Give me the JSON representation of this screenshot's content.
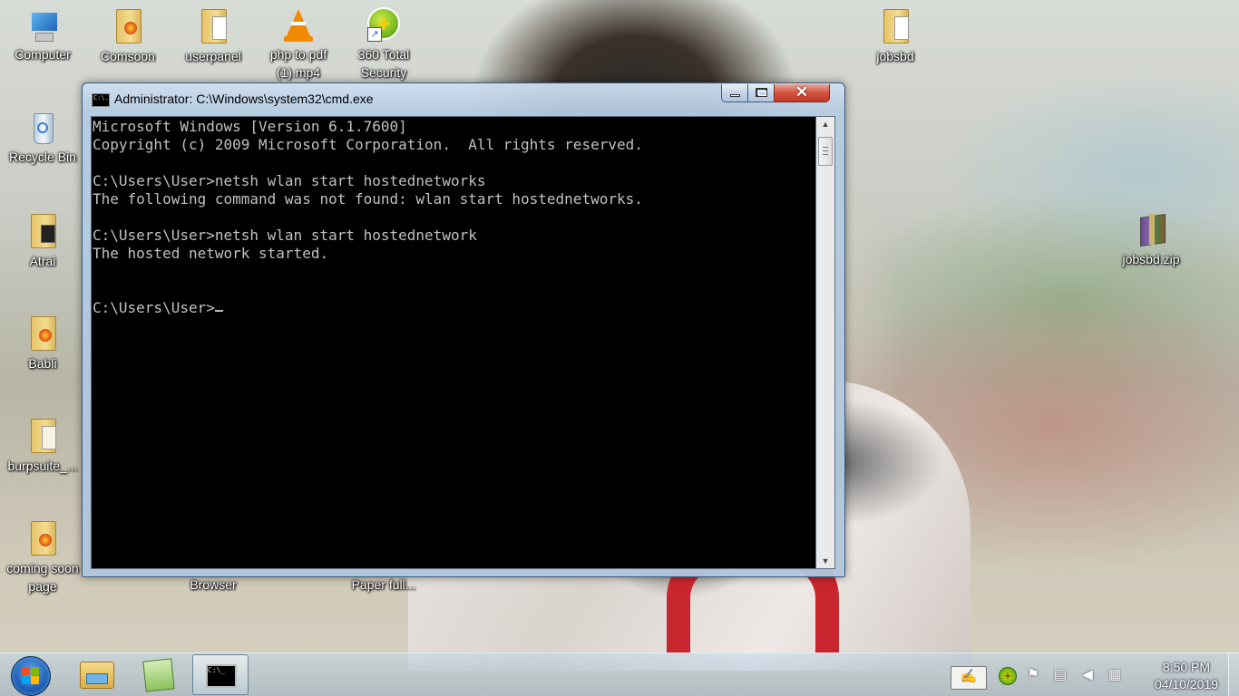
{
  "desktop": {
    "icons": [
      {
        "label": "Computer",
        "icon": "computer-icon"
      },
      {
        "label": "Comsoon",
        "icon": "folder-icon"
      },
      {
        "label": "userpanel",
        "icon": "folder-icon"
      },
      {
        "label": "php to pdf (1).mp4",
        "icon": "vlc-icon"
      },
      {
        "label": "360 Total Security",
        "icon": "360-security-icon"
      },
      {
        "label": "jobsbd",
        "icon": "folder-icon"
      },
      {
        "label": "Recycle Bin",
        "icon": "recycle-bin-icon"
      },
      {
        "label": "Atrai",
        "icon": "folder-icon"
      },
      {
        "label": "jobsbd.zip",
        "icon": "zip-archive-icon"
      },
      {
        "label": "Babli",
        "icon": "folder-icon"
      },
      {
        "label": "burpsuite_...",
        "icon": "folder-icon"
      },
      {
        "label": "coming soon page",
        "icon": "folder-icon"
      },
      {
        "label": "Browser",
        "icon": "shortcut-icon"
      },
      {
        "label": "Paper full...",
        "icon": "shortcut-icon"
      }
    ]
  },
  "cmd": {
    "title": "Administrator: C:\\Windows\\system32\\cmd.exe",
    "lines": [
      "Microsoft Windows [Version 6.1.7600]",
      "Copyright (c) 2009 Microsoft Corporation.  All rights reserved.",
      "",
      "C:\\Users\\User>netsh wlan start hostednetworks",
      "The following command was not found: wlan start hostednetworks.",
      "",
      "C:\\Users\\User>netsh wlan start hostednetwork",
      "The hosted network started.",
      "",
      "",
      "C:\\Users\\User>"
    ],
    "close_glyph": "✕"
  },
  "taskbar": {
    "pinned": [
      "windows-explorer",
      "notepad-plus",
      "command-prompt"
    ],
    "clock_time": "8:50 PM",
    "clock_date": "04/10/2019",
    "cmd_icon_text": "C:\\_"
  },
  "colors": {
    "console_bg": "#000000",
    "console_fg": "#c0c0c0",
    "close_button": "#c8412b",
    "titlebar": "#b9cde3"
  }
}
